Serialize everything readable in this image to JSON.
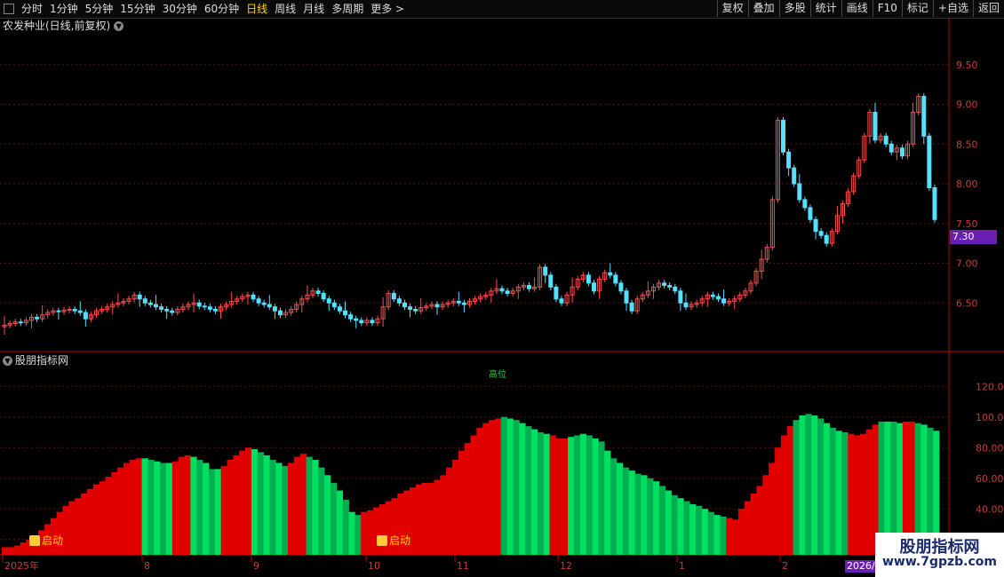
{
  "toolbar": {
    "periods": [
      "分时",
      "1分钟",
      "5分钟",
      "15分钟",
      "30分钟",
      "60分钟",
      "日线",
      "周线",
      "月线",
      "多周期",
      "更多 >"
    ],
    "active": "日线",
    "right_buttons": [
      "复权",
      "叠加",
      "多股",
      "统计",
      "画线",
      "F10",
      "标记",
      "+自选",
      "返回"
    ]
  },
  "main_title": "农发种业(日线,前复权)",
  "indicator_title": "股朋指标网",
  "indicator_annotation": "高位",
  "price_axis": [
    "9.50",
    "9.00",
    "8.50",
    "8.00",
    "7.50",
    "7.00",
    "6.50"
  ],
  "indicator_axis": [
    "120.0",
    "100.0",
    "80.00",
    "60.00",
    "40.00",
    "20.00"
  ],
  "current_price": "7.30",
  "date_axis": [
    "2025年",
    "8",
    "9",
    "10",
    "11",
    "12",
    "1",
    "2",
    "2026/"
  ],
  "signals": [
    "启动",
    "启动"
  ],
  "watermark": {
    "line1": "股朋指标网",
    "line2": "www.7gpzb.com"
  },
  "colors": {
    "up": "#ff4d4d",
    "down": "#54e0ff",
    "red_area": "#e00000",
    "green_area": "#00e060",
    "grid": "#5a1010"
  },
  "chart_data": [
    {
      "type": "candlestick",
      "title": "农发种业(日线,前复权)",
      "ylim": [
        6.0,
        9.9
      ],
      "closes": [
        6.22,
        6.24,
        6.26,
        6.25,
        6.28,
        6.32,
        6.3,
        6.35,
        6.38,
        6.4,
        6.39,
        6.41,
        6.42,
        6.4,
        6.38,
        6.3,
        6.35,
        6.4,
        6.42,
        6.45,
        6.48,
        6.5,
        6.52,
        6.55,
        6.6,
        6.55,
        6.5,
        6.48,
        6.45,
        6.42,
        6.4,
        6.38,
        6.42,
        6.45,
        6.48,
        6.5,
        6.46,
        6.45,
        6.42,
        6.4,
        6.45,
        6.48,
        6.52,
        6.55,
        6.58,
        6.6,
        6.55,
        6.5,
        6.48,
        6.45,
        6.4,
        6.35,
        6.38,
        6.42,
        6.48,
        6.55,
        6.6,
        6.65,
        6.62,
        6.55,
        6.5,
        6.45,
        6.4,
        6.35,
        6.3,
        6.28,
        6.25,
        6.28,
        6.25,
        6.3,
        6.45,
        6.62,
        6.55,
        6.5,
        6.45,
        6.42,
        6.4,
        6.44,
        6.46,
        6.48,
        6.45,
        6.48,
        6.5,
        6.52,
        6.5,
        6.48,
        6.52,
        6.55,
        6.58,
        6.6,
        6.65,
        6.68,
        6.65,
        6.62,
        6.65,
        6.7,
        6.72,
        6.68,
        6.7,
        6.95,
        6.85,
        6.7,
        6.55,
        6.5,
        6.6,
        6.7,
        6.8,
        6.85,
        6.75,
        6.65,
        6.8,
        6.88,
        6.85,
        6.75,
        6.65,
        6.5,
        6.4,
        6.55,
        6.6,
        6.65,
        6.7,
        6.75,
        6.72,
        6.7,
        6.65,
        6.5,
        6.45,
        6.48,
        6.5,
        6.55,
        6.6,
        6.58,
        6.55,
        6.5,
        6.52,
        6.55,
        6.6,
        6.65,
        6.75,
        6.9,
        7.05,
        7.2,
        7.8,
        8.8,
        8.4,
        8.2,
        8.0,
        7.8,
        7.7,
        7.55,
        7.4,
        7.35,
        7.25,
        7.4,
        7.6,
        7.75,
        7.9,
        8.1,
        8.3,
        8.6,
        8.9,
        8.55,
        8.6,
        8.5,
        8.4,
        8.45,
        8.35,
        8.5,
        8.9,
        9.1,
        8.6,
        7.95,
        7.55
      ]
    },
    {
      "type": "area",
      "title": "股朋指标网",
      "ylim": [
        10,
        130
      ],
      "values": [
        15,
        15,
        16,
        18,
        20,
        22,
        26,
        30,
        34,
        38,
        42,
        45,
        47,
        50,
        53,
        56,
        58,
        61,
        64,
        67,
        70,
        72,
        73,
        73,
        72,
        71,
        70,
        70,
        71,
        74,
        75,
        74,
        72,
        70,
        66,
        66,
        68,
        72,
        75,
        78,
        80,
        79,
        77,
        75,
        72,
        70,
        68,
        70,
        74,
        76,
        74,
        72,
        67,
        62,
        57,
        52,
        46,
        38,
        36,
        38,
        39,
        41,
        43,
        45,
        47,
        50,
        52,
        54,
        56,
        57,
        57,
        59,
        62,
        67,
        72,
        78,
        83,
        88,
        93,
        96,
        98,
        99,
        100,
        99,
        98,
        96,
        94,
        92,
        90,
        89,
        88,
        86,
        86,
        87,
        88,
        89,
        88,
        86,
        84,
        78,
        73,
        70,
        67,
        65,
        63,
        62,
        60,
        58,
        55,
        52,
        49,
        47,
        45,
        43,
        42,
        40,
        38,
        36,
        35,
        34,
        33,
        40,
        45,
        50,
        55,
        62,
        70,
        80,
        88,
        94,
        98,
        101,
        102,
        101,
        99,
        96,
        93,
        91,
        90,
        89,
        88,
        89,
        92,
        95,
        97,
        97,
        97,
        96,
        97,
        97,
        96,
        95,
        93,
        91
      ],
      "colors": [
        "r",
        "r",
        "r",
        "r",
        "r",
        "r",
        "r",
        "r",
        "r",
        "r",
        "r",
        "r",
        "r",
        "r",
        "r",
        "r",
        "r",
        "r",
        "r",
        "r",
        "r",
        "r",
        "r",
        "g",
        "g",
        "g",
        "g",
        "g",
        "r",
        "r",
        "r",
        "g",
        "g",
        "g",
        "g",
        "g",
        "r",
        "r",
        "r",
        "r",
        "r",
        "g",
        "g",
        "g",
        "g",
        "g",
        "g",
        "r",
        "r",
        "r",
        "g",
        "g",
        "g",
        "g",
        "g",
        "g",
        "g",
        "g",
        "g",
        "r",
        "r",
        "r",
        "r",
        "r",
        "r",
        "r",
        "r",
        "r",
        "r",
        "r",
        "r",
        "r",
        "r",
        "r",
        "r",
        "r",
        "r",
        "r",
        "r",
        "r",
        "r",
        "r",
        "g",
        "g",
        "g",
        "g",
        "g",
        "g",
        "g",
        "g",
        "r",
        "r",
        "r",
        "g",
        "g",
        "g",
        "g",
        "g",
        "g",
        "g",
        "g",
        "g",
        "g",
        "g",
        "g",
        "g",
        "g",
        "g",
        "g",
        "g",
        "g",
        "g",
        "g",
        "g",
        "g",
        "g",
        "g",
        "g",
        "g",
        "r",
        "r",
        "r",
        "r",
        "r",
        "r",
        "r",
        "r",
        "r",
        "r",
        "r",
        "g",
        "g",
        "g",
        "g",
        "g",
        "g",
        "g",
        "g",
        "g",
        "r",
        "r",
        "r",
        "r",
        "r",
        "g",
        "g",
        "g",
        "g",
        "r",
        "r",
        "g",
        "g",
        "g",
        "g",
        "g"
      ],
      "labels": [
        "启动",
        "启动"
      ]
    }
  ]
}
